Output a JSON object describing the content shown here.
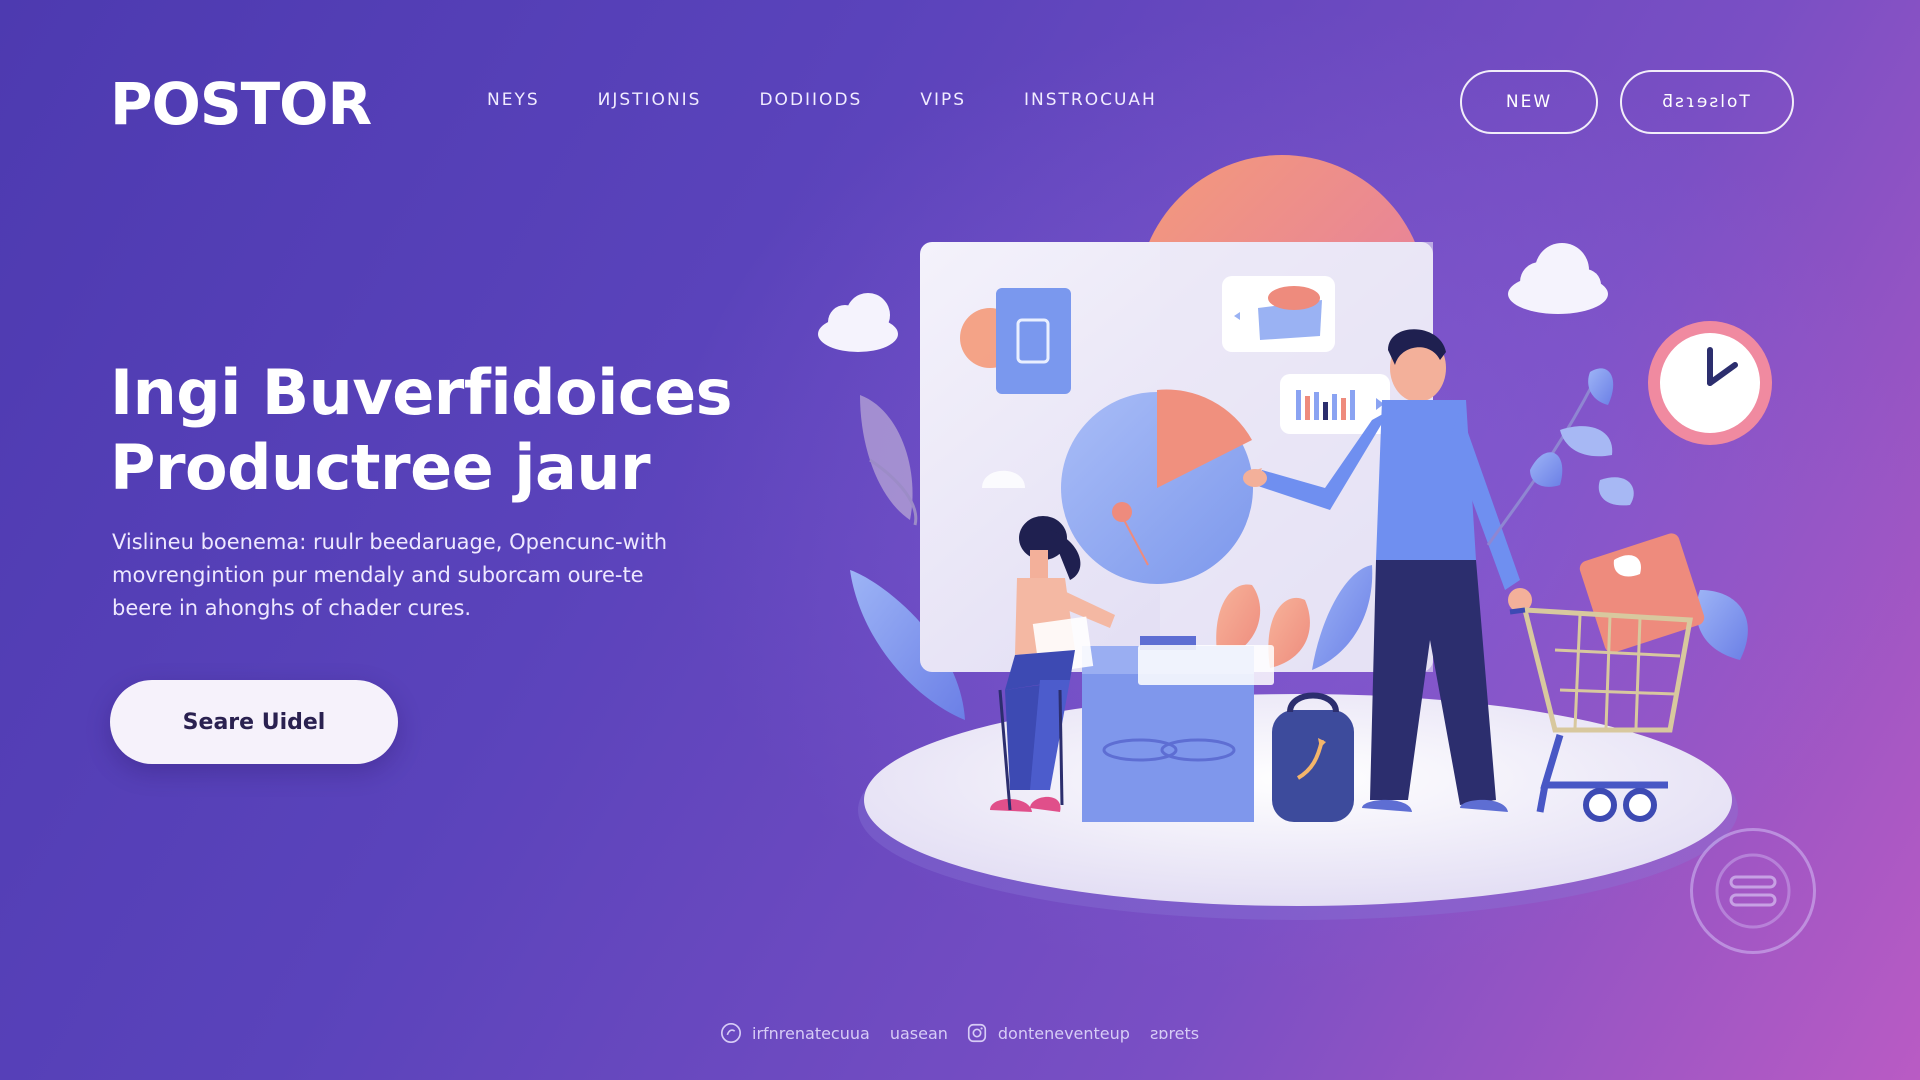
{
  "header": {
    "logo": "POSTOR",
    "nav": [
      {
        "label": "NEYS"
      },
      {
        "label": "ИJSTIONIS"
      },
      {
        "label": "DODIIODS"
      },
      {
        "label": "VIPS"
      },
      {
        "label": "INSTROCUAH"
      }
    ],
    "btn_new": "NEW",
    "btn_second": "ƌƨɿɘƨloT"
  },
  "hero": {
    "title_line1": "Ingi Buverfidoices",
    "title_line2": "Productree jaur",
    "desc_line1": "Vislineu boenemа: ruulr beedaruage, Opencunc-with",
    "desc_line2": "movrengintion pur mendaly and suborcam oure-te",
    "desc_line3": "beere in ahonghs of chader cures.",
    "cta": "Seare Uidel"
  },
  "footer": {
    "text1": "irfnrenatecuua",
    "text2": "uasean",
    "text3": "donteneventeup",
    "text4": "ƨɒrets"
  },
  "colors": {
    "bg_start": "#4d3ab0",
    "bg_end": "#b95bc4",
    "accent_coral": "#f08a7e",
    "accent_blue": "#6f8ff0",
    "navy": "#2c2e6e"
  }
}
